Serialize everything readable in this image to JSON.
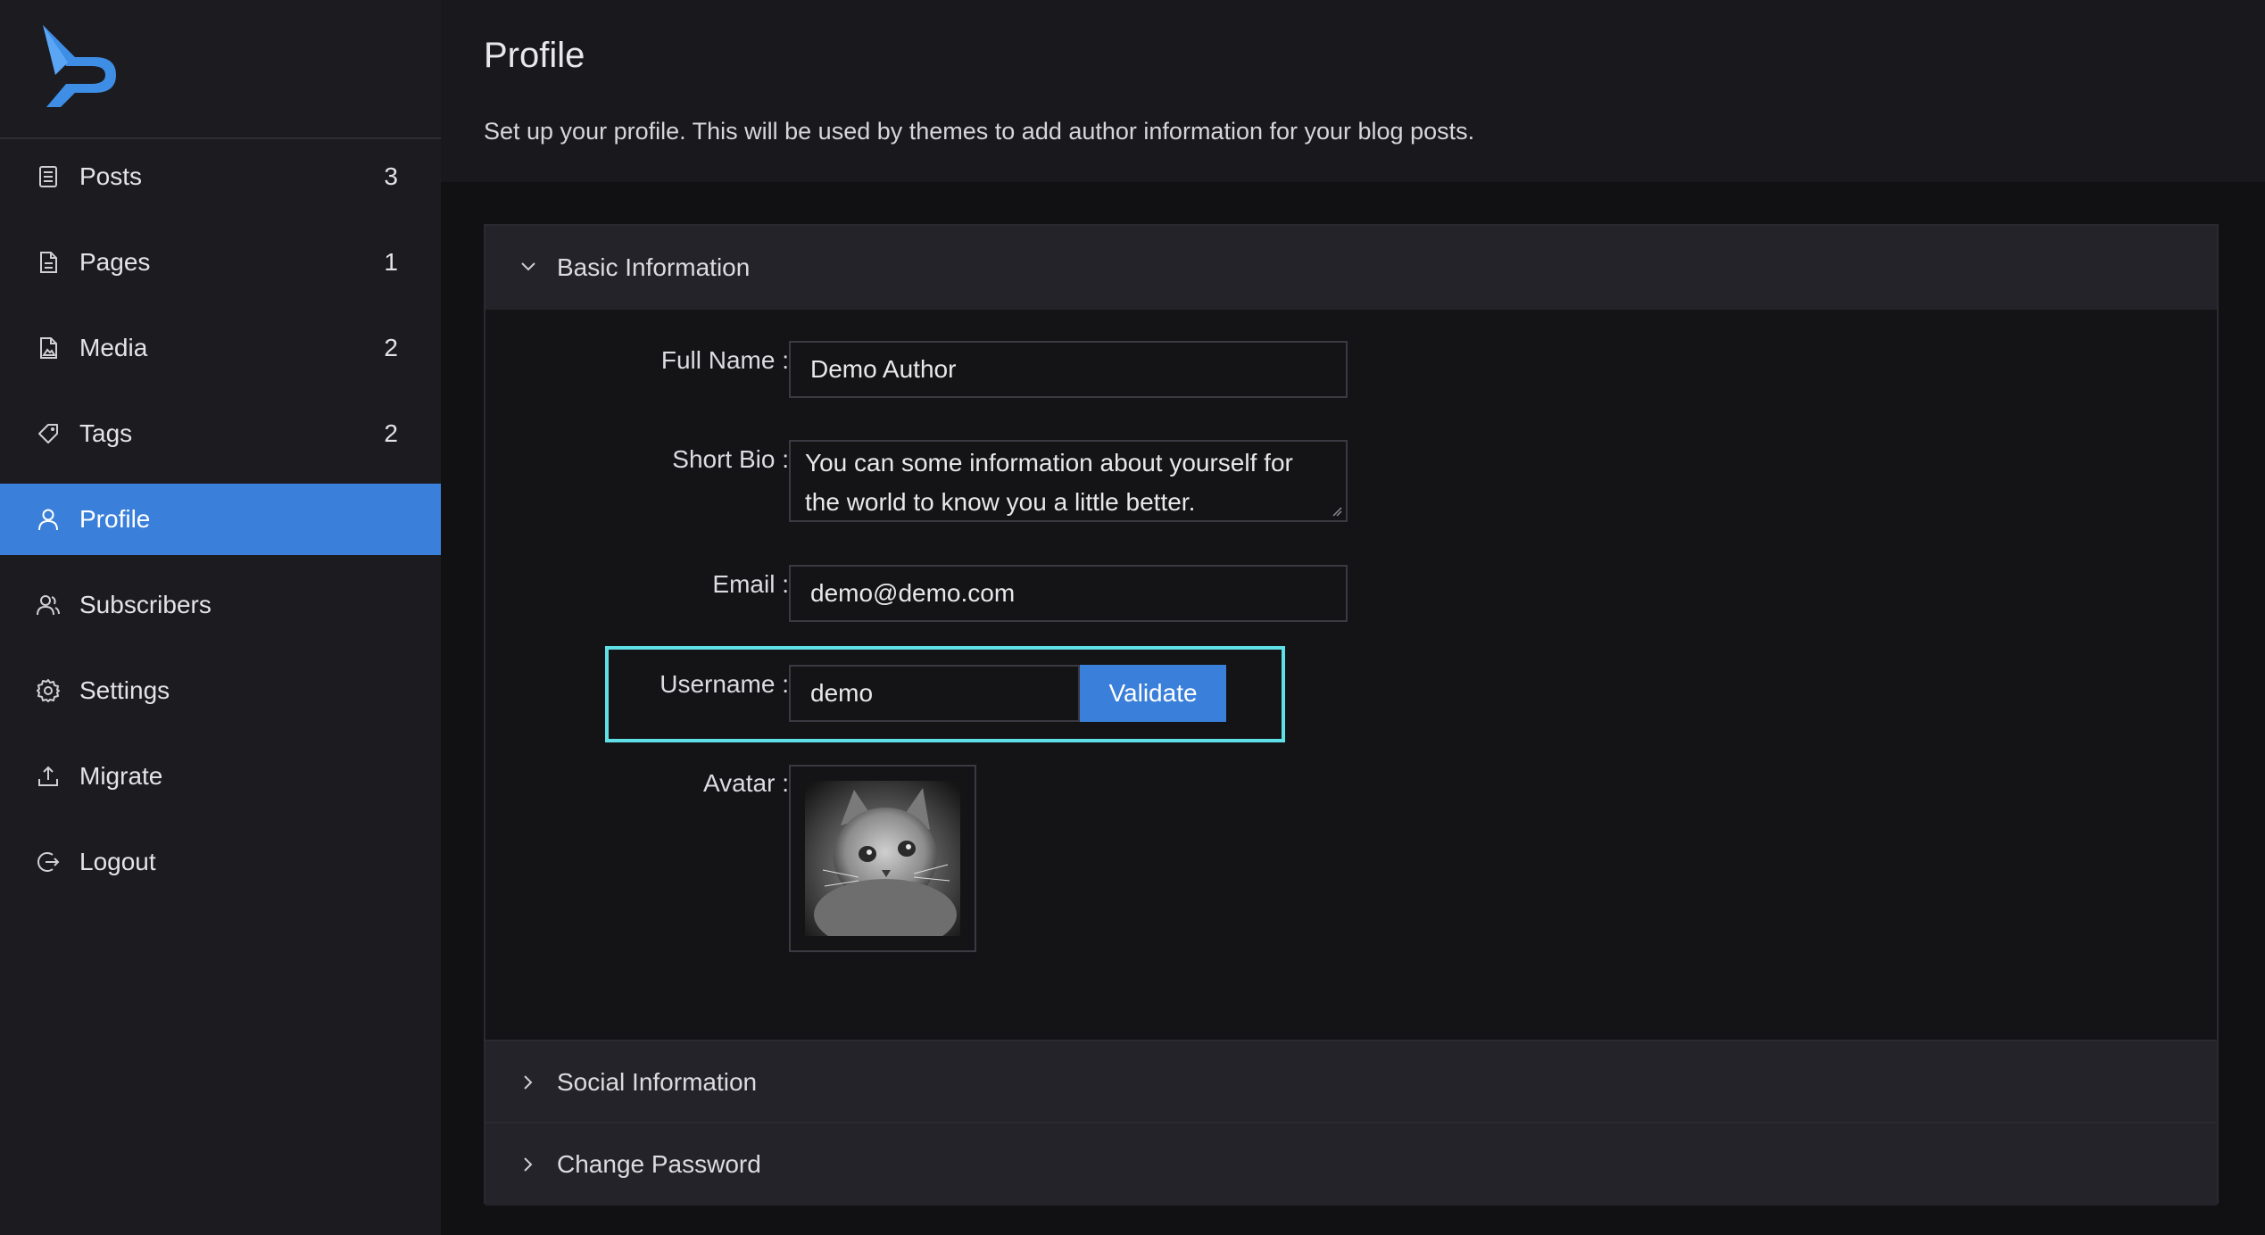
{
  "sidebar": {
    "logo_icon": "publii-logo-icon",
    "items": [
      {
        "label": "Posts",
        "count": "3",
        "icon": "posts-icon"
      },
      {
        "label": "Pages",
        "count": "1",
        "icon": "pages-icon"
      },
      {
        "label": "Media",
        "count": "2",
        "icon": "media-icon"
      },
      {
        "label": "Tags",
        "count": "2",
        "icon": "tag-icon"
      },
      {
        "label": "Profile",
        "count": "",
        "icon": "user-icon",
        "active": true
      },
      {
        "label": "Subscribers",
        "count": "",
        "icon": "subscribers-icon"
      },
      {
        "label": "Settings",
        "count": "",
        "icon": "gear-icon"
      },
      {
        "label": "Migrate",
        "count": "",
        "icon": "upload-icon"
      },
      {
        "label": "Logout",
        "count": "",
        "icon": "logout-icon"
      }
    ]
  },
  "header": {
    "title": "Profile",
    "description": "Set up your profile. This will be used by themes to add author information for your blog posts."
  },
  "sections": {
    "basic": {
      "label": "Basic Information",
      "expanded": true
    },
    "social": {
      "label": "Social Information",
      "expanded": false
    },
    "password": {
      "label": "Change Password",
      "expanded": false
    }
  },
  "form": {
    "full_name": {
      "label": "Full Name",
      "value": "Demo Author"
    },
    "short_bio": {
      "label": "Short Bio",
      "line1": "You can some information about yourself for",
      "line2": "the world to know you a little better."
    },
    "email": {
      "label": "Email",
      "value": "demo@demo.com"
    },
    "username": {
      "label": "Username",
      "value": "demo",
      "button": "Validate"
    },
    "avatar": {
      "label": "Avatar"
    }
  },
  "colors": {
    "accent": "#3a7fd9",
    "highlight": "#5fe0e6",
    "sidebar_bg": "#1b1b20",
    "main_bg": "#111114"
  }
}
